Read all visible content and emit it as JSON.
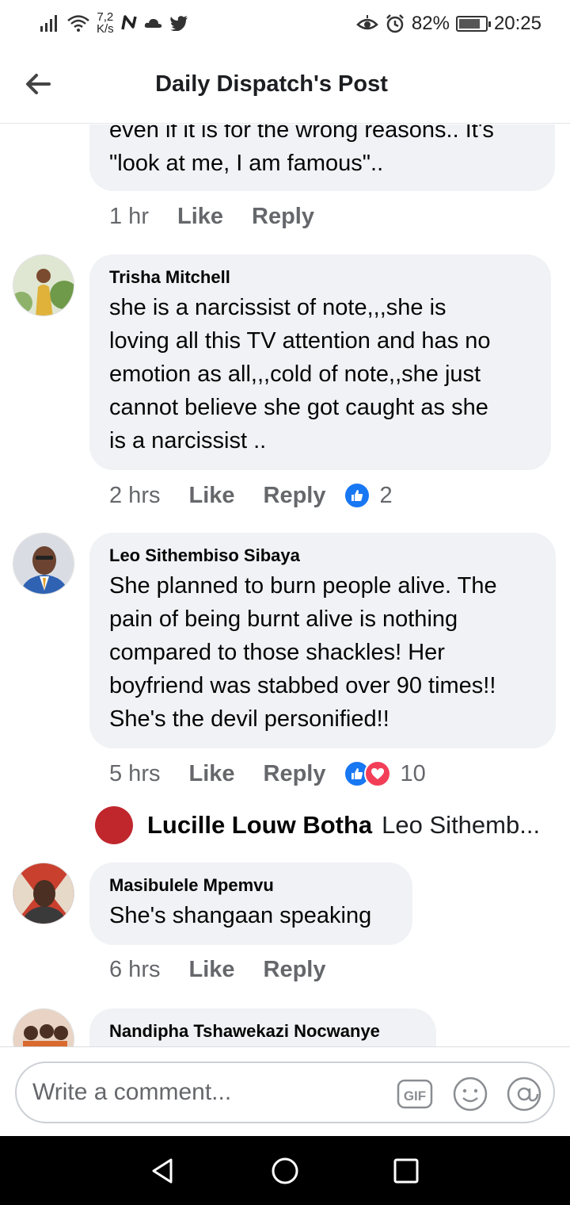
{
  "status_bar": {
    "speed_value": "7,2",
    "speed_unit": "K/s",
    "battery": "82%",
    "time": "20:25",
    "battery_level": 0.82
  },
  "header": {
    "title": "Daily Dispatch's Post"
  },
  "comments": [
    {
      "author": "",
      "text_lines": [
        "even if it is for the wrong reasons.. It's",
        "\"look at me, I am famous\".."
      ],
      "time": "1 hr",
      "like": "Like",
      "reply": "Reply"
    },
    {
      "author": "Trisha Mitchell",
      "text_lines": [
        "she is a narcissist of note,,,she is",
        "loving all this TV attention and has no",
        "emotion as all,,,cold of note,,she just",
        "cannot believe she got caught as she",
        "is a narcissist .."
      ],
      "time": "2 hrs",
      "like": "Like",
      "reply": "Reply",
      "reaction_count": "2"
    },
    {
      "author": "Leo Sithembiso Sibaya",
      "text_lines": [
        "She planned to burn people alive. The",
        "pain of being burnt alive is nothing",
        "compared to those shackles! Her",
        "boyfriend was stabbed over 90 times!!",
        "She's the devil personified!!"
      ],
      "time": "5 hrs",
      "like": "Like",
      "reply": "Reply",
      "reaction_count": "10"
    },
    {
      "author": "Masibulele Mpemvu",
      "text_lines": [
        "She's shangaan speaking"
      ],
      "time": "6 hrs",
      "like": "Like",
      "reply": "Reply"
    },
    {
      "author": "Nandipha Tshawekazi Nocwanye",
      "text_lines": []
    }
  ],
  "nested_reply": {
    "author": "Lucille Louw Botha",
    "text": "Leo Sithemb..."
  },
  "composer": {
    "placeholder": "Write a comment...",
    "gif_label": "GIF"
  },
  "colors": {
    "bubble": "#f0f2f5",
    "like_blue": "#1877f2",
    "love_red": "#f33e58",
    "meta_grey": "#65676b"
  }
}
